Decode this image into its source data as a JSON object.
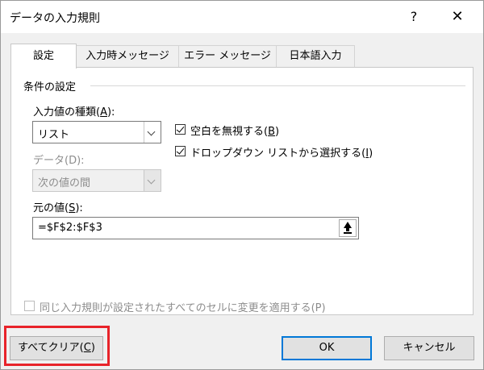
{
  "window": {
    "title": "データの入力規則",
    "help_glyph": "?",
    "close_glyph": "✕"
  },
  "tabs": [
    {
      "label": "設定",
      "active": true
    },
    {
      "label": "入力時メッセージ",
      "active": false
    },
    {
      "label": "エラー メッセージ",
      "active": false
    },
    {
      "label": "日本語入力",
      "active": false
    }
  ],
  "conditions": {
    "group_label": "条件の設定",
    "allow_label_pre": "入力値の種類(",
    "allow_label_key": "A",
    "allow_label_post": "):",
    "allow_value": "リスト",
    "data_label": "データ(D):",
    "data_value": "次の値の間",
    "ignore_blank_pre": "空白を無視する(",
    "ignore_blank_key": "B",
    "ignore_blank_post": ")",
    "ignore_blank_checked": true,
    "dropdown_pre": "ドロップダウン リストから選択する(",
    "dropdown_key": "I",
    "dropdown_post": ")",
    "dropdown_checked": true,
    "source_label_pre": "元の値(",
    "source_label_key": "S",
    "source_label_post": "):",
    "source_value": "=$F$2:$F$3",
    "apply_all_label": "同じ入力規則が設定されたすべてのセルに変更を適用する(P)",
    "apply_all_checked": false
  },
  "buttons": {
    "clear_pre": "すべてクリア(",
    "clear_key": "C",
    "clear_post": ")",
    "ok": "OK",
    "cancel": "キャンセル"
  },
  "colors": {
    "accent": "#0078d7",
    "highlight": "#e8232a"
  }
}
